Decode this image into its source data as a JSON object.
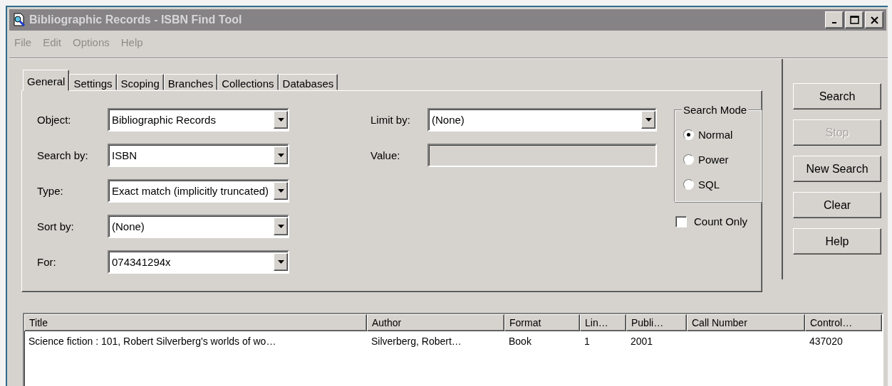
{
  "window": {
    "title": "Bibliographic Records - ISBN Find Tool"
  },
  "menu": [
    {
      "label": "File",
      "disabled": true
    },
    {
      "label": "Edit",
      "disabled": true
    },
    {
      "label": "Options",
      "disabled": true
    },
    {
      "label": "Help",
      "disabled": true
    }
  ],
  "tabs": [
    {
      "label": "General",
      "selected": true
    },
    {
      "label": "Settings",
      "selected": false
    },
    {
      "label": "Scoping",
      "selected": false
    },
    {
      "label": "Branches",
      "selected": false
    },
    {
      "label": "Collections",
      "selected": false
    },
    {
      "label": "Databases",
      "selected": false
    }
  ],
  "fields": [
    {
      "label": "Object:",
      "value": "Bibliographic Records"
    },
    {
      "label": "Search by:",
      "value": "ISBN"
    },
    {
      "label": "Type:",
      "value": "Exact match (implicitly truncated)"
    },
    {
      "label": "Sort by:",
      "value": "(None)"
    },
    {
      "label": "For:",
      "value": "074341294x"
    }
  ],
  "limit_by": {
    "label": "Limit by:",
    "value": "(None)"
  },
  "value_field": {
    "label": "Value:",
    "disabled": true
  },
  "search_mode": {
    "title": "Search Mode",
    "options": [
      {
        "label": "Normal",
        "selected": true
      },
      {
        "label": "Power",
        "selected": false
      },
      {
        "label": "SQL",
        "selected": false
      }
    ]
  },
  "count_only": {
    "label": "Count Only",
    "checked": false
  },
  "buttons": [
    {
      "label": "Search",
      "disabled": false
    },
    {
      "label": "Stop",
      "disabled": true
    },
    {
      "label": "New Search",
      "disabled": false
    },
    {
      "label": "Clear",
      "disabled": false
    },
    {
      "label": "Help",
      "disabled": false
    }
  ],
  "table": {
    "columns": [
      "Title",
      "Author",
      "Format",
      "Lin…",
      "Publi…",
      "Call Number",
      "Control…"
    ],
    "rows": [
      [
        "Science fiction : 101, Robert Silverberg's worlds of wo…",
        "Silverberg, Robert…",
        "Book",
        "1",
        "2001",
        null,
        "437020"
      ]
    ]
  }
}
